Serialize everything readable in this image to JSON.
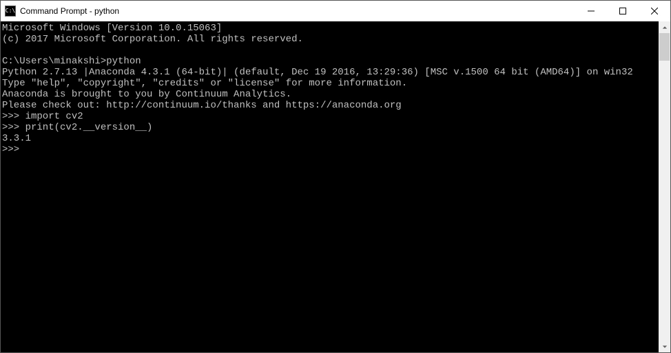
{
  "titlebar": {
    "icon_label": "C:\\",
    "title": "Command Prompt - python"
  },
  "terminal": {
    "lines": [
      "Microsoft Windows [Version 10.0.15063]",
      "(c) 2017 Microsoft Corporation. All rights reserved.",
      "",
      "C:\\Users\\minakshi>python",
      "Python 2.7.13 |Anaconda 4.3.1 (64-bit)| (default, Dec 19 2016, 13:29:36) [MSC v.1500 64 bit (AMD64)] on win32",
      "Type \"help\", \"copyright\", \"credits\" or \"license\" for more information.",
      "Anaconda is brought to you by Continuum Analytics.",
      "Please check out: http://continuum.io/thanks and https://anaconda.org",
      ">>> import cv2",
      ">>> print(cv2.__version__)",
      "3.3.1",
      ">>> "
    ]
  }
}
